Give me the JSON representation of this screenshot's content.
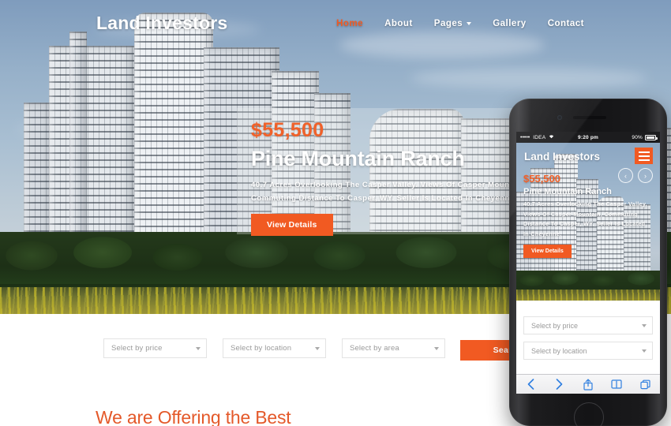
{
  "site": {
    "brand": "Land Investors"
  },
  "nav": {
    "items": [
      {
        "label": "Home",
        "active": true
      },
      {
        "label": "About",
        "active": false
      },
      {
        "label": "Pages",
        "active": false,
        "has_dropdown": true
      },
      {
        "label": "Gallery",
        "active": false
      },
      {
        "label": "Contact",
        "active": false
      }
    ]
  },
  "hero": {
    "price": "$55,500",
    "title": "Pine Mountain Ranch",
    "description": "40.7 Acres Overlooking The Casper Valley. Views Of Casper Mountain, Commuting Distance To Casper, WY. Seller Is Located In Cheyenne.",
    "button_label": "View Details"
  },
  "search": {
    "price_placeholder": "Select by price",
    "location_placeholder": "Select by location",
    "area_placeholder": "Select by area",
    "button_label": "Search"
  },
  "offering": {
    "heading": "We are Offering the Best"
  },
  "phone": {
    "status": {
      "signal": "•••••",
      "carrier": "IDEA",
      "wifi": "▾",
      "time": "9:20 pm",
      "battery_pct": "90%"
    },
    "brand": "Land Investors",
    "menu_icon": "hamburger-icon",
    "hero": {
      "price": "$55,500",
      "title": "Pine Mountain Ranch",
      "description": "40.7 Acres Overlooking The Casper Valley. Views Of Casper Mountain, Commuting Distance To Casper, WY. Seller Is Located In Cheyenne.",
      "button_label": "View Details",
      "prev_label": "‹",
      "next_label": "›"
    },
    "filters": {
      "price_placeholder": "Select by price",
      "location_placeholder": "Select by location"
    },
    "toolbar": {
      "back": "back-icon",
      "forward": "forward-icon",
      "share": "share-icon",
      "bookmarks": "bookmarks-icon",
      "tabs": "tabs-icon"
    }
  },
  "colors": {
    "accent": "#f15a22",
    "accent_price": "#f0612a",
    "heading": "#e4592a",
    "nav_text": "#ffffff",
    "select_text": "#9a9a9a"
  }
}
